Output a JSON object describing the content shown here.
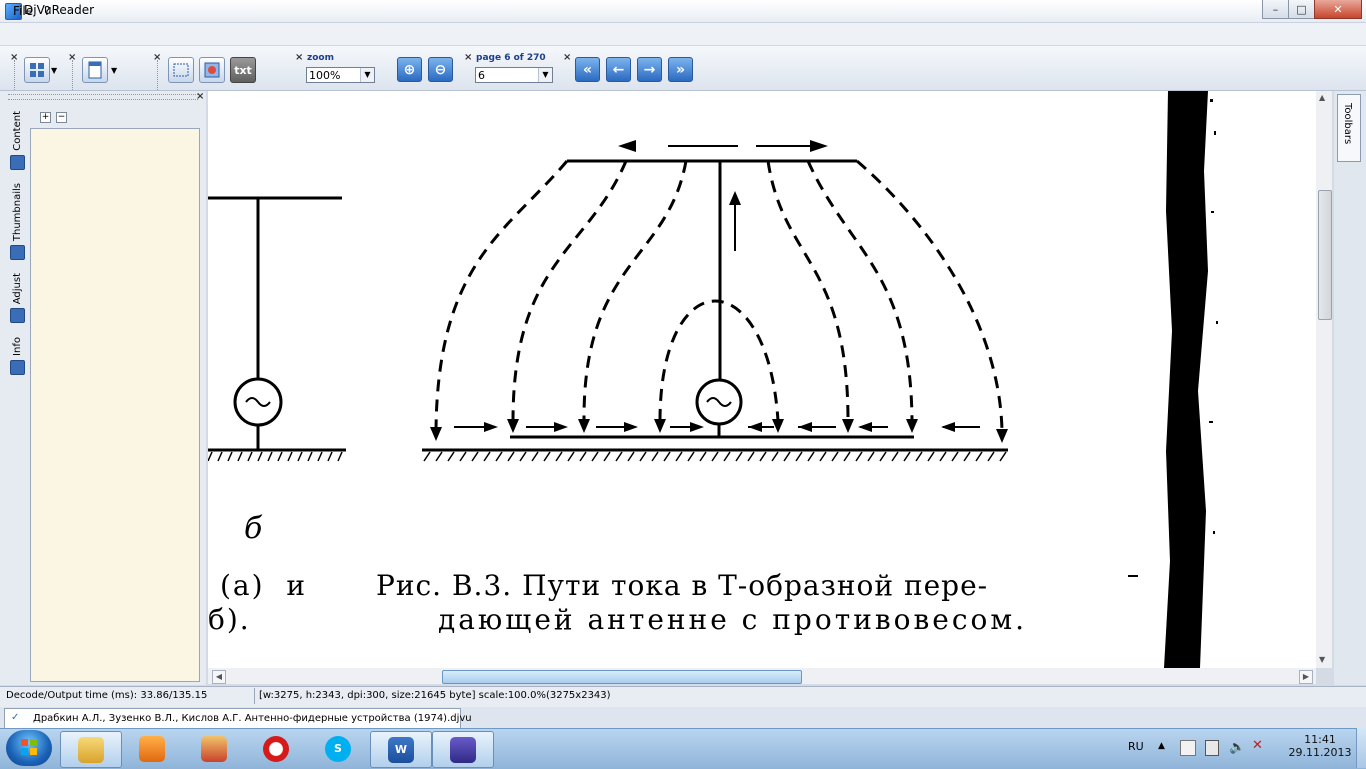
{
  "window": {
    "title": "DjVuReader",
    "controls": {
      "minimize": "–",
      "maximize": "□",
      "close": "✕"
    }
  },
  "menu": {
    "items": [
      "File",
      "?"
    ]
  },
  "toolbar": {
    "zoom_label": "zoom",
    "zoom_value": "100%",
    "page_label": "page 6 of 270",
    "page_value": "6",
    "text_button": "txt",
    "icons": {
      "layout": "layout-icon",
      "page": "page-icon",
      "select": "select-icon",
      "image": "image-icon",
      "zoom_in": "zoom-in-icon",
      "zoom_out": "zoom-out-icon",
      "first": "first-page-icon",
      "prev": "prev-page-icon",
      "next": "next-page-icon",
      "last": "last-page-icon"
    }
  },
  "side_tabs": [
    {
      "label": "Content"
    },
    {
      "label": "Thumbnails"
    },
    {
      "label": "Adjust"
    },
    {
      "label": "Info"
    }
  ],
  "side_panel": {
    "expand": "+",
    "collapse": "−"
  },
  "right_tab": {
    "label": "Toolbars"
  },
  "document": {
    "fig_label_b": "б",
    "left_caption_1": "(a)  и",
    "left_caption_2": "б).",
    "caption_line1": "Рис. В.3. Пути тока в Т-образной пере-",
    "caption_line2": "дающей антенне с противовесом."
  },
  "status": {
    "decode": "Decode/Output time (ms): 33.86/135.15",
    "info": "[w:3275, h:2343, dpi:300, size:21645 byte] scale:100.0%(3275x2343)"
  },
  "doc_tab": {
    "label": "Драбкин А.Л., Зузенко В.Л., Кислов А.Г. Антенно-фидерные устройства (1974).djvu"
  },
  "taskbar": {
    "items": [
      "explorer",
      "media-player",
      "installer",
      "opera",
      "skype",
      "word",
      "djvureader"
    ],
    "lang": "RU",
    "time": "11:41",
    "date": "29.11.2013"
  },
  "colors": {
    "accent": "#2b6ac0",
    "panel": "#fbf5e3",
    "taskbar": "#8fb4d9"
  }
}
